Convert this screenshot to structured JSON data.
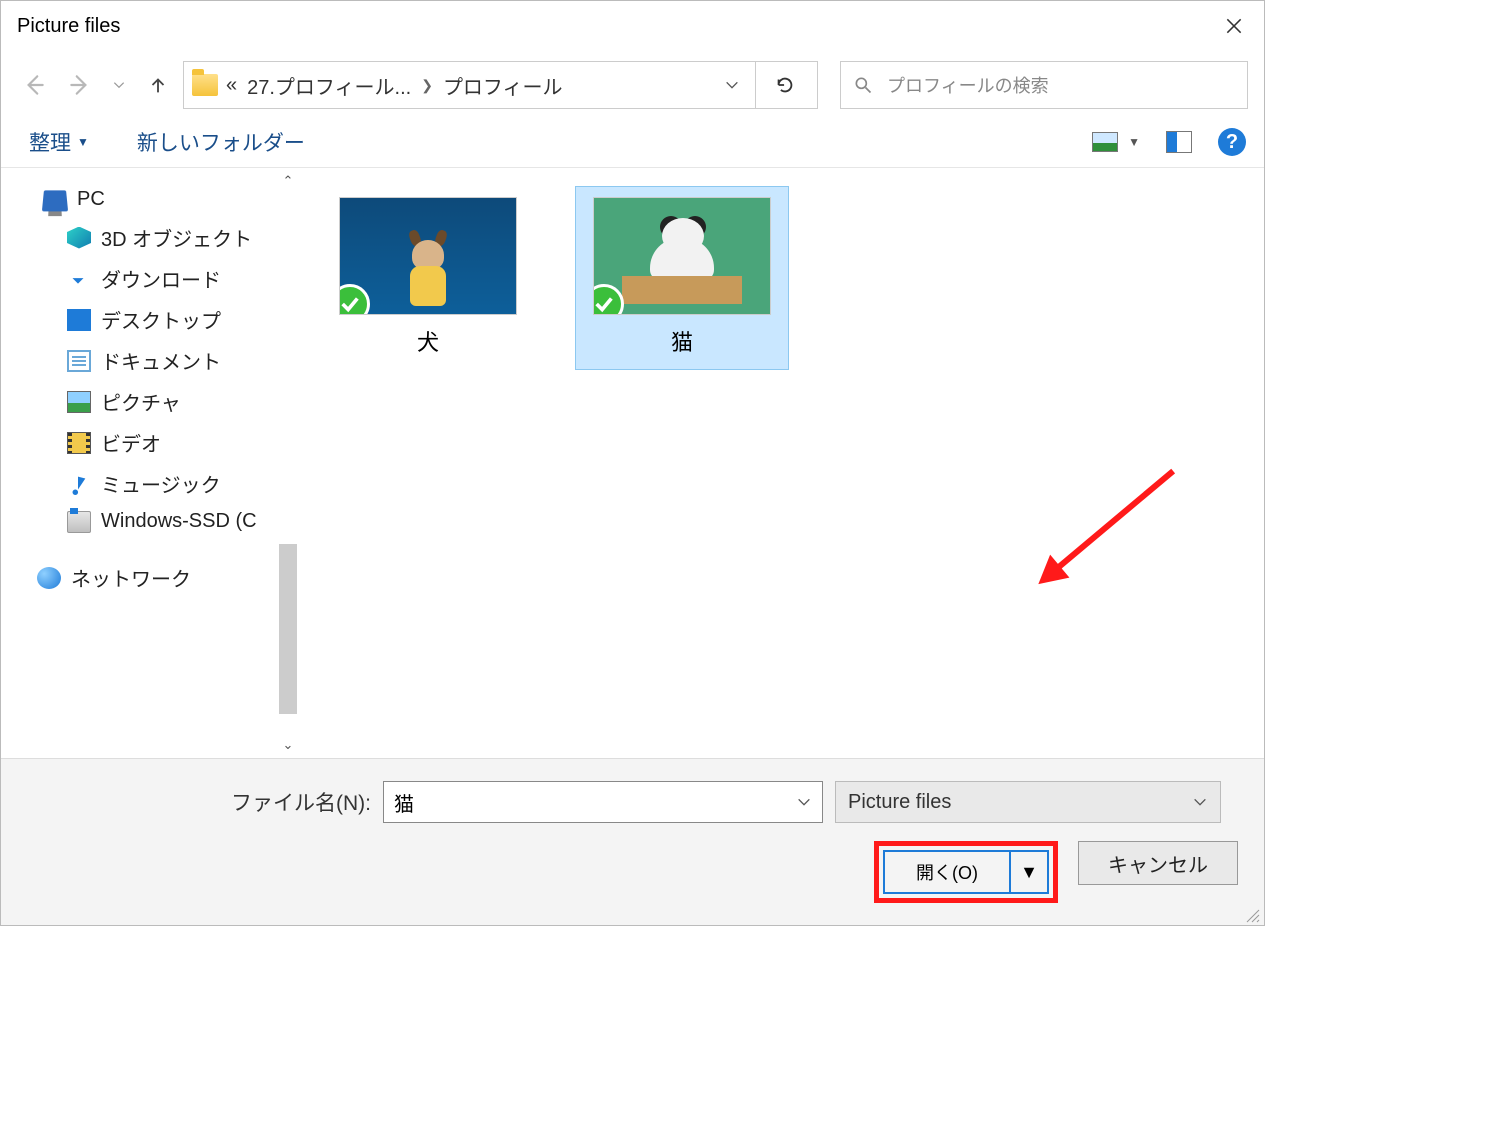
{
  "title": "Picture files",
  "breadcrumb": {
    "chevron_left": "«",
    "parent": "27.プロフィール...",
    "current": "プロフィール"
  },
  "search": {
    "placeholder": "プロフィールの検索"
  },
  "toolbar": {
    "organize": "整理",
    "new_folder": "新しいフォルダー"
  },
  "sidebar": {
    "pc": "PC",
    "items": [
      "3D オブジェクト",
      "ダウンロード",
      "デスクトップ",
      "ドキュメント",
      "ピクチャ",
      "ビデオ",
      "ミュージック",
      "Windows-SSD (C"
    ],
    "network": "ネットワーク"
  },
  "files": [
    {
      "name": "犬",
      "selected": false
    },
    {
      "name": "猫",
      "selected": true
    }
  ],
  "footer": {
    "filename_label": "ファイル名(N):",
    "filename_value": "猫",
    "filetype": "Picture files",
    "open": "開く(O)",
    "cancel": "キャンセル"
  }
}
